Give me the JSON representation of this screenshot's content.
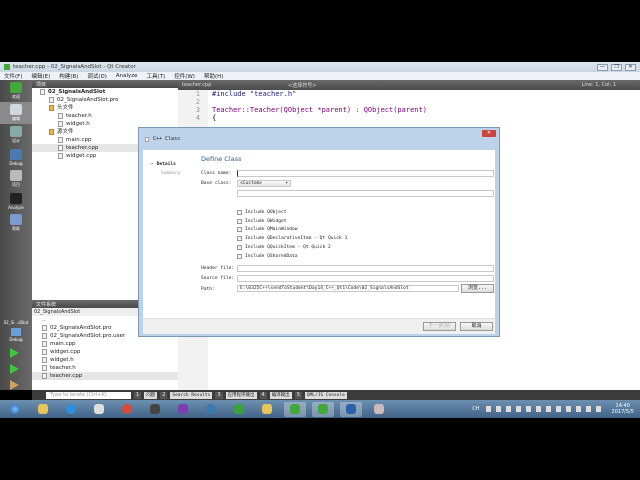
{
  "window": {
    "title": "teacher.cpp - 02_SignalsAndSlot - Qt Creator",
    "min": "—",
    "max": "❐",
    "close": "✕"
  },
  "menu": [
    "文件(F)",
    "编辑(E)",
    "构建(B)",
    "调试(D)",
    "Analyze",
    "工具(T)",
    "控件(W)",
    "帮助(H)"
  ],
  "modes": [
    "欢迎",
    "编辑",
    "设计",
    "Debug",
    "项目",
    "Analyze",
    "帮助"
  ],
  "run_target": {
    "project": "02_Si...dSlot",
    "config": "Debug"
  },
  "project_panel": {
    "title": "项目",
    "tree": [
      {
        "label": "02_SignalsAndSlot",
        "level": 0
      },
      {
        "label": "02_SignalsAndSlot.pro",
        "level": 1
      },
      {
        "label": "头文件",
        "level": 1
      },
      {
        "label": "teacher.h",
        "level": 2
      },
      {
        "label": "widget.h",
        "level": 2
      },
      {
        "label": "源文件",
        "level": 1
      },
      {
        "label": "main.cpp",
        "level": 2
      },
      {
        "label": "teacher.cpp",
        "level": 2
      },
      {
        "label": "widget.cpp",
        "level": 2
      }
    ]
  },
  "fs_panel": {
    "title": "文件系统",
    "path": "02_SignalsAndSlot",
    "items": [
      "..",
      "02_SignalsAndSlot.pro",
      "02_SignalsAndSlot.pro.user",
      "main.cpp",
      "widget.cpp",
      "widget.h",
      "teacher.h",
      "teacher.cpp"
    ]
  },
  "editor": {
    "tab": "teacher.cpp",
    "symbol": "<选择符号>",
    "position": "Line: 1, Col: 1",
    "lines": [
      {
        "n": "1",
        "text": "#include \"teacher.h\""
      },
      {
        "n": "2",
        "text": ""
      },
      {
        "n": "3",
        "text": "Teacher::Teacher(QObject *parent) : QObject(parent)"
      },
      {
        "n": "4",
        "text": "{"
      }
    ]
  },
  "dialog": {
    "title": "C++ Class",
    "steps": [
      "Details",
      "Summary"
    ],
    "heading": "Define Class",
    "class_name_label": "Class name:",
    "class_name": "",
    "base_class_label": "Base class:",
    "base_class": "<Custom>",
    "checks": [
      "Include QObject",
      "Include QWidget",
      "Include QMainWindow",
      "Include QDeclarativeItem - Qt Quick 1",
      "Include QQuickItem - Qt Quick 2",
      "Include QSharedData"
    ],
    "header_label": "Header file:",
    "source_label": "Source file:",
    "path_label": "Path:",
    "path": "E:\\0325C++\\sendToStudent\\Day14_C++_Qt1\\Code\\02_SignalsAndSlot",
    "browse": "浏览...",
    "next": "下一步(N)",
    "cancel": "取消"
  },
  "output_bar": {
    "locate_placeholder": "Type to locate (Ctrl+K)",
    "tabs": [
      {
        "n": "1",
        "label": "问题"
      },
      {
        "n": "2",
        "label": "Search Results"
      },
      {
        "n": "3",
        "label": "应用程序输出"
      },
      {
        "n": "4",
        "label": "编译输出"
      },
      {
        "n": "5",
        "label": "QML/JS Console"
      }
    ]
  },
  "taskbar": {
    "time": "14:40",
    "date": "2017/5/5",
    "lang": "CH"
  }
}
